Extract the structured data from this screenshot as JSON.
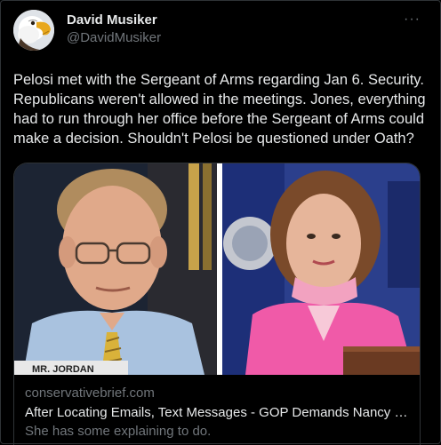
{
  "tweet": {
    "author": {
      "display_name": "David Musiker",
      "handle": "@DavidMusiker",
      "avatar_icon": "eagle-avatar-icon"
    },
    "more_icon": "more-options-icon",
    "more_glyph": "···",
    "text": "Pelosi met with the Sergeant of Arms regarding Jan 6. Security. Republicans weren't allowed in the meetings. Jones, everything had to run through her office before the Sergeant of Arms could make a decision. Shouldn't Pelosi be questioned under Oath?",
    "card": {
      "image_placard_text": "MR. JORDAN",
      "domain": "conservativebrief.com",
      "title": "After Locating Emails, Text Messages - GOP Demands Nancy P...",
      "description": "She has some explaining to do."
    }
  },
  "colors": {
    "background": "#000000",
    "text_primary": "#e7e9ea",
    "text_secondary": "#71767b",
    "border": "#2f3336"
  }
}
